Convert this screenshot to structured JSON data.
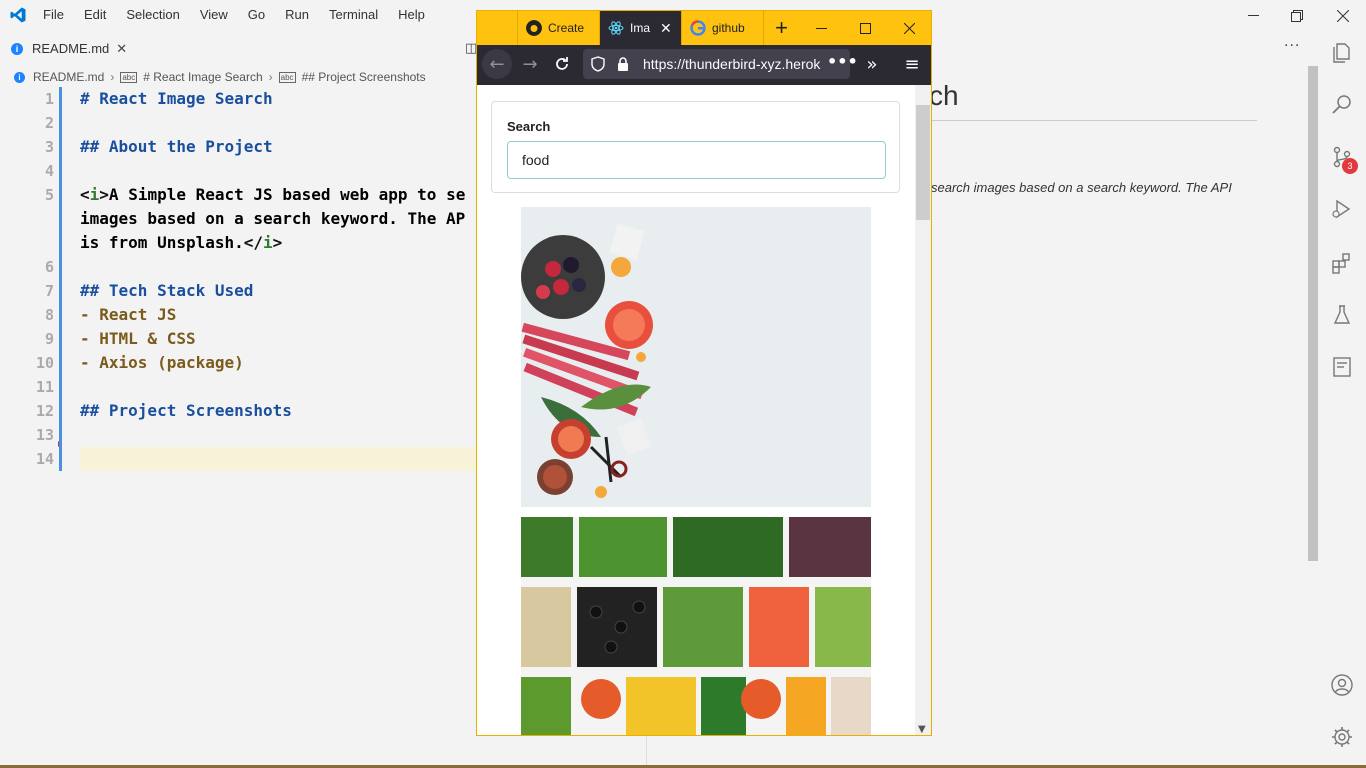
{
  "app": {
    "menu": [
      "File",
      "Edit",
      "Selection",
      "View",
      "Go",
      "Run",
      "Terminal",
      "Help"
    ]
  },
  "editor_tab": {
    "label": "README.md",
    "close": "✕"
  },
  "breadcrumb": {
    "file": "README.md",
    "h1": "# React Image Search",
    "h2": "## Project Screenshots"
  },
  "code_lines": [
    {
      "n": "1",
      "type": "h",
      "text": "# React Image Search"
    },
    {
      "n": "2",
      "type": "blank",
      "text": ""
    },
    {
      "n": "3",
      "type": "h",
      "text": "## About the Project"
    },
    {
      "n": "4",
      "type": "blank",
      "text": ""
    },
    {
      "n": "5",
      "type": "html",
      "text": "<i>A Simple React JS based web app to se"
    },
    {
      "n": "",
      "type": "plain",
      "text": "images based on a search keyword. The AP"
    },
    {
      "n": "",
      "type": "htmlend",
      "text": "is from Unsplash.</i>"
    },
    {
      "n": "6",
      "type": "blank",
      "text": ""
    },
    {
      "n": "7",
      "type": "h",
      "text": "## Tech Stack Used"
    },
    {
      "n": "8",
      "type": "li",
      "text": "- React JS"
    },
    {
      "n": "9",
      "type": "li",
      "text": "- HTML & CSS"
    },
    {
      "n": "10",
      "type": "li",
      "text": "- Axios (package)"
    },
    {
      "n": "11",
      "type": "blank",
      "text": ""
    },
    {
      "n": "12",
      "type": "h",
      "text": "## Project Screenshots"
    },
    {
      "n": "13",
      "type": "blank",
      "text": ""
    },
    {
      "n": "14",
      "type": "blank",
      "text": ""
    }
  ],
  "preview": {
    "title_fragment": "ch",
    "text_fragment": "search images based on a search keyword. The API"
  },
  "activity_bar": {
    "icons": [
      "explorer-icon",
      "search-icon",
      "source-control-icon",
      "run-debug-icon",
      "extensions-icon",
      "testing-icon",
      "notebook-icon",
      "account-icon",
      "settings-gear-icon"
    ],
    "scm_badge": "3"
  },
  "browser": {
    "tabs": [
      {
        "label": "Create",
        "icon": "github-icon",
        "active": false
      },
      {
        "label": "Ima",
        "icon": "react-icon",
        "active": true
      },
      {
        "label": "github",
        "icon": "google-icon",
        "active": false
      }
    ],
    "url": "https://thunderbird-xyz.herok",
    "search_label": "Search",
    "search_value": "food",
    "images": [
      "food-image-fruits",
      "food-image-salad-bar"
    ]
  },
  "colors": {
    "firefox_tabstrip": "#ffc30f",
    "firefox_toolbar": "#2b2a33",
    "markdown_heading": "#1a4f9e",
    "markdown_list": "#7a5b1c",
    "scm_badge": "#e0393e"
  }
}
